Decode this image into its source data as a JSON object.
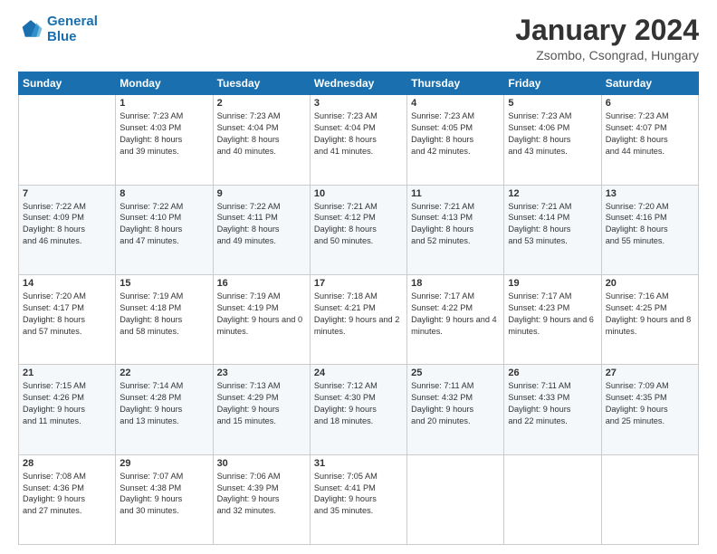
{
  "logo": {
    "line1": "General",
    "line2": "Blue"
  },
  "header": {
    "title": "January 2024",
    "subtitle": "Zsombo, Csongrad, Hungary"
  },
  "weekdays": [
    "Sunday",
    "Monday",
    "Tuesday",
    "Wednesday",
    "Thursday",
    "Friday",
    "Saturday"
  ],
  "weeks": [
    [
      {
        "day": null,
        "sunrise": "",
        "sunset": "",
        "daylight": ""
      },
      {
        "day": "1",
        "sunrise": "7:23 AM",
        "sunset": "4:03 PM",
        "daylight": "8 hours and 39 minutes."
      },
      {
        "day": "2",
        "sunrise": "7:23 AM",
        "sunset": "4:04 PM",
        "daylight": "8 hours and 40 minutes."
      },
      {
        "day": "3",
        "sunrise": "7:23 AM",
        "sunset": "4:04 PM",
        "daylight": "8 hours and 41 minutes."
      },
      {
        "day": "4",
        "sunrise": "7:23 AM",
        "sunset": "4:05 PM",
        "daylight": "8 hours and 42 minutes."
      },
      {
        "day": "5",
        "sunrise": "7:23 AM",
        "sunset": "4:06 PM",
        "daylight": "8 hours and 43 minutes."
      },
      {
        "day": "6",
        "sunrise": "7:23 AM",
        "sunset": "4:07 PM",
        "daylight": "8 hours and 44 minutes."
      }
    ],
    [
      {
        "day": "7",
        "sunrise": "7:22 AM",
        "sunset": "4:09 PM",
        "daylight": "8 hours and 46 minutes."
      },
      {
        "day": "8",
        "sunrise": "7:22 AM",
        "sunset": "4:10 PM",
        "daylight": "8 hours and 47 minutes."
      },
      {
        "day": "9",
        "sunrise": "7:22 AM",
        "sunset": "4:11 PM",
        "daylight": "8 hours and 49 minutes."
      },
      {
        "day": "10",
        "sunrise": "7:21 AM",
        "sunset": "4:12 PM",
        "daylight": "8 hours and 50 minutes."
      },
      {
        "day": "11",
        "sunrise": "7:21 AM",
        "sunset": "4:13 PM",
        "daylight": "8 hours and 52 minutes."
      },
      {
        "day": "12",
        "sunrise": "7:21 AM",
        "sunset": "4:14 PM",
        "daylight": "8 hours and 53 minutes."
      },
      {
        "day": "13",
        "sunrise": "7:20 AM",
        "sunset": "4:16 PM",
        "daylight": "8 hours and 55 minutes."
      }
    ],
    [
      {
        "day": "14",
        "sunrise": "7:20 AM",
        "sunset": "4:17 PM",
        "daylight": "8 hours and 57 minutes."
      },
      {
        "day": "15",
        "sunrise": "7:19 AM",
        "sunset": "4:18 PM",
        "daylight": "8 hours and 58 minutes."
      },
      {
        "day": "16",
        "sunrise": "7:19 AM",
        "sunset": "4:19 PM",
        "daylight": "9 hours and 0 minutes."
      },
      {
        "day": "17",
        "sunrise": "7:18 AM",
        "sunset": "4:21 PM",
        "daylight": "9 hours and 2 minutes."
      },
      {
        "day": "18",
        "sunrise": "7:17 AM",
        "sunset": "4:22 PM",
        "daylight": "9 hours and 4 minutes."
      },
      {
        "day": "19",
        "sunrise": "7:17 AM",
        "sunset": "4:23 PM",
        "daylight": "9 hours and 6 minutes."
      },
      {
        "day": "20",
        "sunrise": "7:16 AM",
        "sunset": "4:25 PM",
        "daylight": "9 hours and 8 minutes."
      }
    ],
    [
      {
        "day": "21",
        "sunrise": "7:15 AM",
        "sunset": "4:26 PM",
        "daylight": "9 hours and 11 minutes."
      },
      {
        "day": "22",
        "sunrise": "7:14 AM",
        "sunset": "4:28 PM",
        "daylight": "9 hours and 13 minutes."
      },
      {
        "day": "23",
        "sunrise": "7:13 AM",
        "sunset": "4:29 PM",
        "daylight": "9 hours and 15 minutes."
      },
      {
        "day": "24",
        "sunrise": "7:12 AM",
        "sunset": "4:30 PM",
        "daylight": "9 hours and 18 minutes."
      },
      {
        "day": "25",
        "sunrise": "7:11 AM",
        "sunset": "4:32 PM",
        "daylight": "9 hours and 20 minutes."
      },
      {
        "day": "26",
        "sunrise": "7:11 AM",
        "sunset": "4:33 PM",
        "daylight": "9 hours and 22 minutes."
      },
      {
        "day": "27",
        "sunrise": "7:09 AM",
        "sunset": "4:35 PM",
        "daylight": "9 hours and 25 minutes."
      }
    ],
    [
      {
        "day": "28",
        "sunrise": "7:08 AM",
        "sunset": "4:36 PM",
        "daylight": "9 hours and 27 minutes."
      },
      {
        "day": "29",
        "sunrise": "7:07 AM",
        "sunset": "4:38 PM",
        "daylight": "9 hours and 30 minutes."
      },
      {
        "day": "30",
        "sunrise": "7:06 AM",
        "sunset": "4:39 PM",
        "daylight": "9 hours and 32 minutes."
      },
      {
        "day": "31",
        "sunrise": "7:05 AM",
        "sunset": "4:41 PM",
        "daylight": "9 hours and 35 minutes."
      },
      {
        "day": null,
        "sunrise": "",
        "sunset": "",
        "daylight": ""
      },
      {
        "day": null,
        "sunrise": "",
        "sunset": "",
        "daylight": ""
      },
      {
        "day": null,
        "sunrise": "",
        "sunset": "",
        "daylight": ""
      }
    ]
  ]
}
